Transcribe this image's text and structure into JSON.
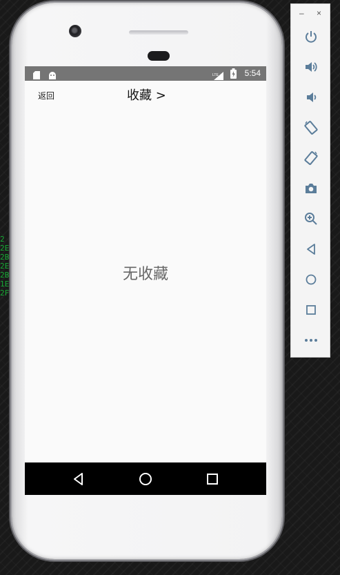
{
  "status_bar": {
    "time": "5:54",
    "network": "LTE",
    "left_icons": [
      "sd-card-icon",
      "android-icon"
    ],
    "right_icons": [
      "signal-icon",
      "battery-icon"
    ]
  },
  "header": {
    "back_label": "返回",
    "title": "收藏 >"
  },
  "content": {
    "empty_text": "无收藏"
  },
  "navigation_bar": {
    "buttons": [
      "back-triangle-icon",
      "home-circle-icon",
      "recents-square-icon"
    ]
  },
  "emulator_toolbar": {
    "minimize_label": "–",
    "close_label": "×",
    "buttons": [
      "power-icon",
      "volume-up-icon",
      "volume-down-icon",
      "rotate-left-icon",
      "rotate-right-icon",
      "camera-icon",
      "zoom-icon",
      "back-icon",
      "home-icon",
      "overview-icon",
      "more-icon"
    ]
  },
  "colors": {
    "status_bar": "#757575",
    "screen_background": "#fafafa",
    "toolbar_icon": "#5b7d9a",
    "nav_bar": "#000000"
  }
}
